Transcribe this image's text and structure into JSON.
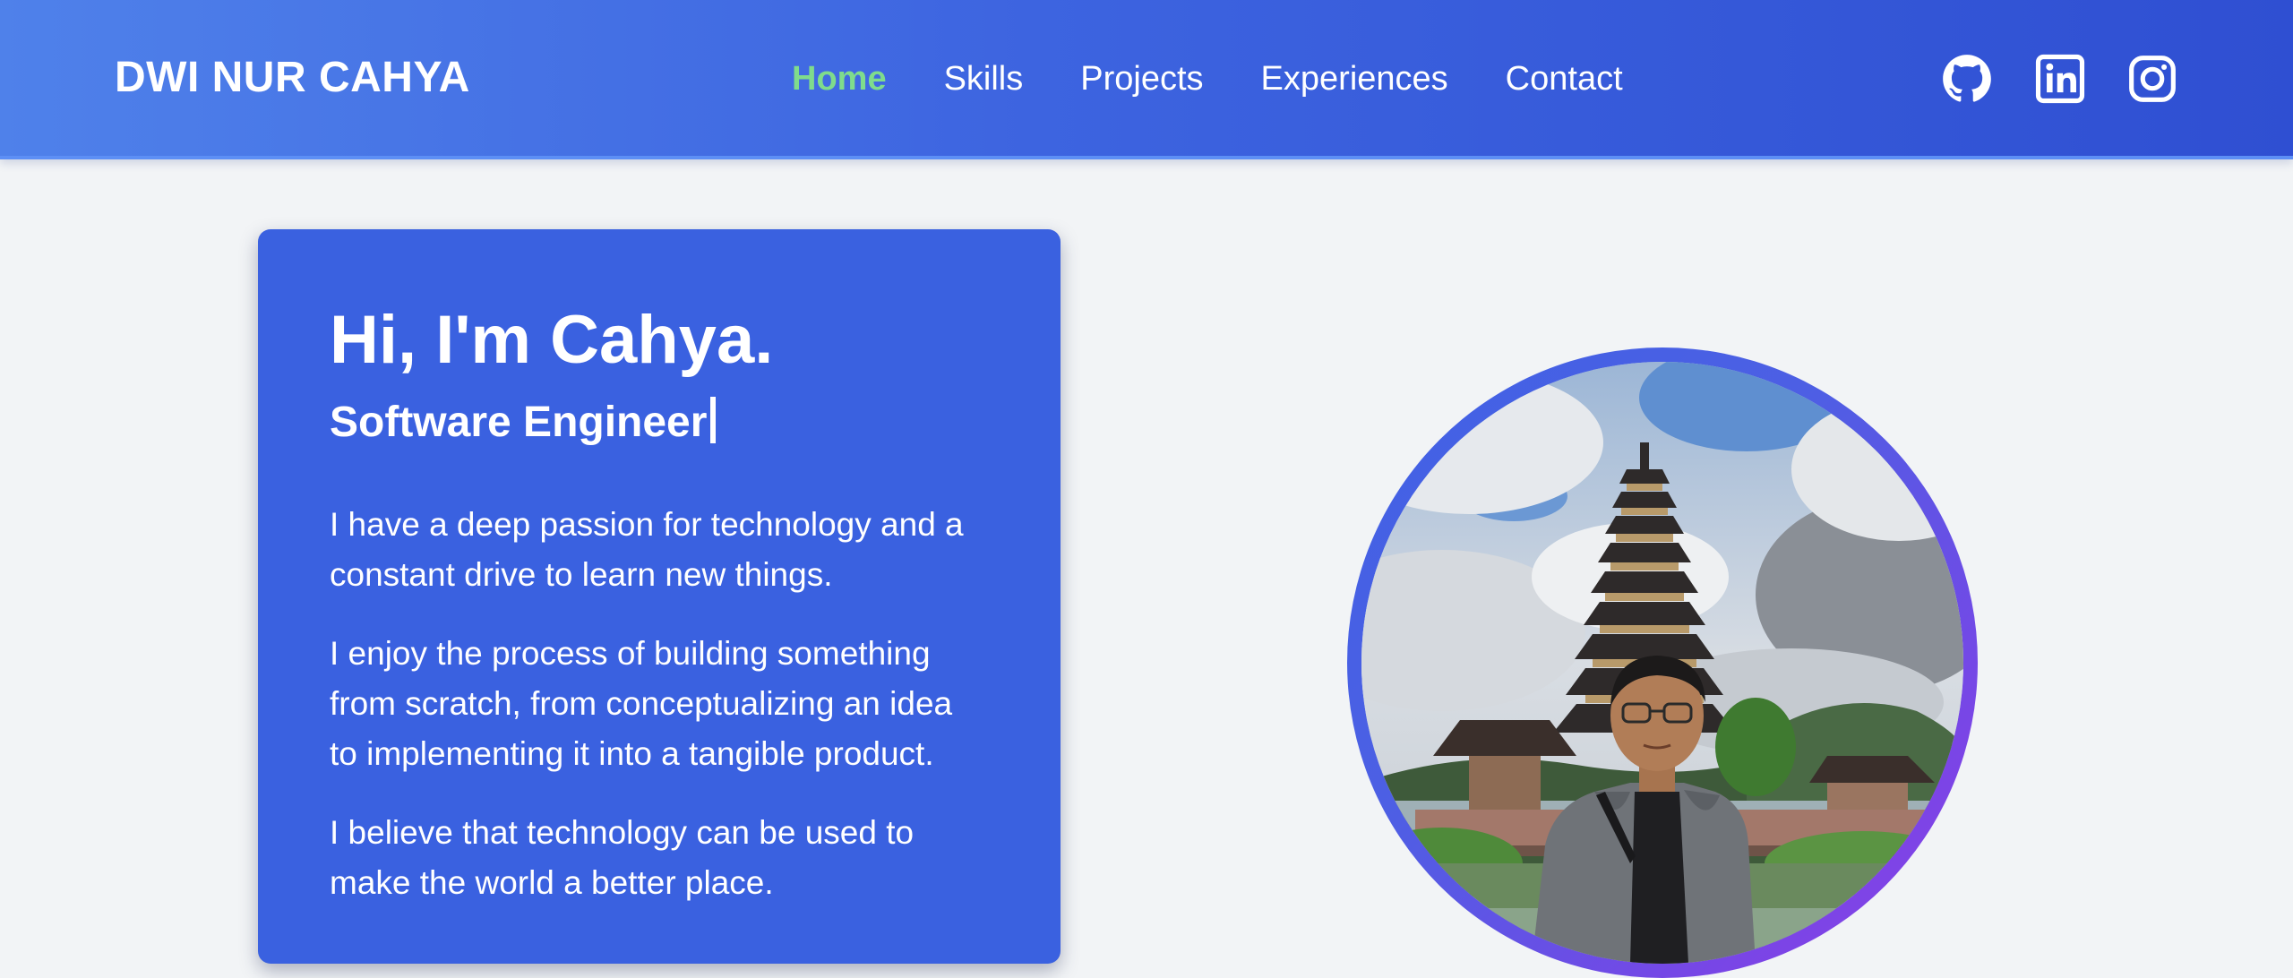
{
  "header": {
    "brand": "DWI NUR CAHYA",
    "nav": [
      {
        "label": "Home",
        "active": true
      },
      {
        "label": "Skills",
        "active": false
      },
      {
        "label": "Projects",
        "active": false
      },
      {
        "label": "Experiences",
        "active": false
      },
      {
        "label": "Contact",
        "active": false
      }
    ],
    "social_icons": [
      "github-icon",
      "linkedin-icon",
      "instagram-icon"
    ]
  },
  "hero": {
    "greeting": "Hi, I'm Cahya.",
    "role": "Software Engineer",
    "paragraphs": [
      "I have a deep passion for technology and a constant drive to learn new things.",
      "I enjoy the process of building something from scratch, from conceptualizing an idea to implementing it into a tangible product.",
      "I believe that technology can be used to make the world a better place."
    ],
    "portrait_description": "profile-photo"
  },
  "colors": {
    "header_gradient_start": "#4f81ea",
    "header_gradient_end": "#2f4fd2",
    "active_nav": "#7fdc8c",
    "card_background": "#3a61e0",
    "page_background": "#f2f4f6",
    "ring_gradient_end": "#8b3fe8"
  }
}
